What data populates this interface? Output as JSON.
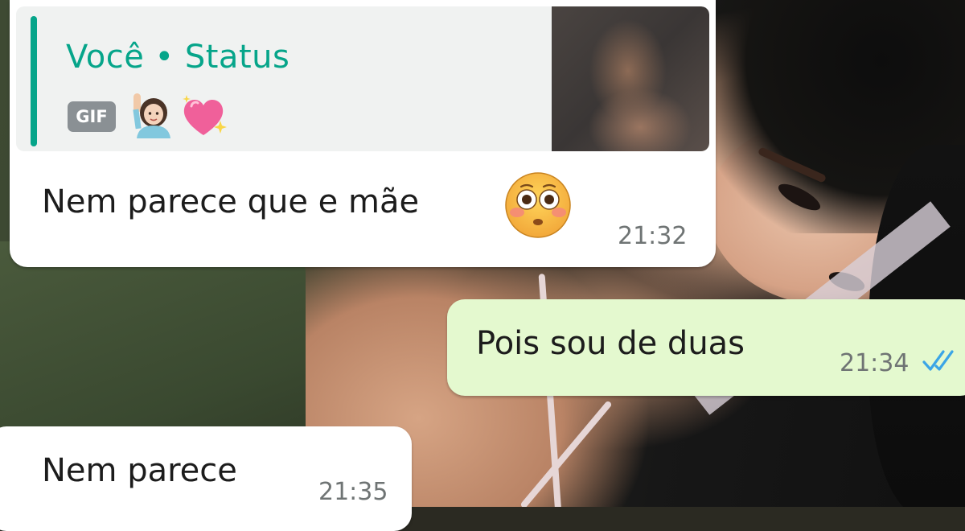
{
  "messages": [
    {
      "direction": "incoming",
      "reply": {
        "author": "Você • Status",
        "badge": "GIF",
        "emojis": [
          "person-raising-hand-emoji",
          "sparkling-heart-emoji"
        ]
      },
      "text": "Nem parece que e mãe",
      "trailing_emoji": "flushed-face-emoji",
      "time": "21:32"
    },
    {
      "direction": "outgoing",
      "text": "Pois sou de duas",
      "time": "21:34",
      "status": "read"
    },
    {
      "direction": "incoming",
      "text": "Nem parece",
      "time": "21:35"
    }
  ],
  "colors": {
    "accent": "#06a58a",
    "incoming_bubble": "#ffffff",
    "outgoing_bubble": "#e4f9cf",
    "read_ticks": "#3ba5e6",
    "time": "#6f7474"
  },
  "icons": [
    "double-check-read-icon"
  ]
}
